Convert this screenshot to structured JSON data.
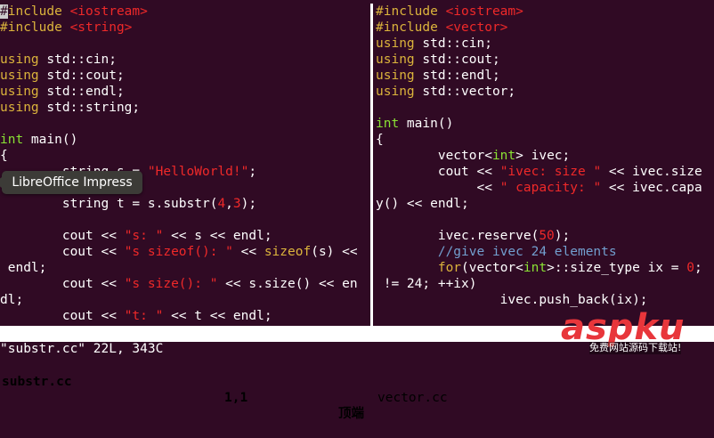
{
  "left_pane": {
    "lines": [
      [
        [
          "#",
          "cursor"
        ],
        [
          "include ",
          "keyword"
        ],
        [
          "<iostream>",
          "string"
        ]
      ],
      [
        [
          "#include ",
          "keyword"
        ],
        [
          "<string>",
          "string"
        ]
      ],
      [],
      [
        [
          "using",
          "keyword"
        ],
        [
          " std::cin;",
          ""
        ]
      ],
      [
        [
          "using",
          "keyword"
        ],
        [
          " std::cout;",
          ""
        ]
      ],
      [
        [
          "using",
          "keyword"
        ],
        [
          " std::endl;",
          ""
        ]
      ],
      [
        [
          "using",
          "keyword"
        ],
        [
          " std::string;",
          ""
        ]
      ],
      [],
      [
        [
          "int",
          "type"
        ],
        [
          " main()",
          ""
        ]
      ],
      [
        [
          "{",
          ""
        ]
      ],
      [
        [
          "        string s = ",
          ""
        ],
        [
          "\"HelloWorld!\"",
          "string"
        ],
        [
          ";",
          ""
        ]
      ],
      [],
      [
        [
          "        string t = s.substr(",
          ""
        ],
        [
          "4",
          "number"
        ],
        [
          ",",
          ""
        ],
        [
          "3",
          "number"
        ],
        [
          ");",
          ""
        ]
      ],
      [],
      [
        [
          "        cout << ",
          ""
        ],
        [
          "\"s: \"",
          "string"
        ],
        [
          " << s << endl;",
          ""
        ]
      ],
      [
        [
          "        cout << ",
          ""
        ],
        [
          "\"s sizeof(): \"",
          "string"
        ],
        [
          " << ",
          ""
        ],
        [
          "sizeof",
          "func"
        ],
        [
          "(s) <<",
          ""
        ]
      ],
      [
        [
          " endl;",
          ""
        ]
      ],
      [
        [
          "        cout << ",
          ""
        ],
        [
          "\"s size(): \"",
          "string"
        ],
        [
          " << s.size() << en",
          ""
        ]
      ],
      [
        [
          "dl;",
          ""
        ]
      ],
      [
        [
          "        cout << ",
          ""
        ],
        [
          "\"t: \"",
          "string"
        ],
        [
          " << t << endl;",
          ""
        ]
      ]
    ]
  },
  "right_pane": {
    "lines": [
      [
        [
          "#include ",
          "keyword"
        ],
        [
          "<iostream>",
          "string"
        ]
      ],
      [
        [
          "#include ",
          "keyword"
        ],
        [
          "<vector>",
          "string"
        ]
      ],
      [
        [
          "using",
          "keyword"
        ],
        [
          " std::cin;",
          ""
        ]
      ],
      [
        [
          "using",
          "keyword"
        ],
        [
          " std::cout;",
          ""
        ]
      ],
      [
        [
          "using",
          "keyword"
        ],
        [
          " std::endl;",
          ""
        ]
      ],
      [
        [
          "using",
          "keyword"
        ],
        [
          " std::vector;",
          ""
        ]
      ],
      [],
      [
        [
          "int",
          "type"
        ],
        [
          " main()",
          ""
        ]
      ],
      [
        [
          "{",
          ""
        ]
      ],
      [
        [
          "        vector<",
          ""
        ],
        [
          "int",
          "type"
        ],
        [
          "> ivec;",
          ""
        ]
      ],
      [
        [
          "        cout << ",
          ""
        ],
        [
          "\"ivec: size \"",
          "string"
        ],
        [
          " << ivec.size",
          ""
        ]
      ],
      [
        [
          "             << ",
          ""
        ],
        [
          "\" capacity: \"",
          "string"
        ],
        [
          " << ivec.capa",
          ""
        ]
      ],
      [
        [
          "y() << endl;",
          ""
        ]
      ],
      [],
      [
        [
          "        ivec.reserve(",
          ""
        ],
        [
          "50",
          "number"
        ],
        [
          ");",
          ""
        ]
      ],
      [
        [
          "        //give ivec 24 elements",
          "comment"
        ]
      ],
      [
        [
          "        ",
          ""
        ],
        [
          "for",
          "keyword"
        ],
        [
          "(vector<",
          ""
        ],
        [
          "int",
          "type"
        ],
        [
          ">::size_type ix = ",
          ""
        ],
        [
          "0",
          "number"
        ],
        [
          ";",
          ""
        ]
      ],
      [
        [
          " != 24; ++ix)",
          ""
        ]
      ],
      [
        [
          "                ivec.push_back(ix);",
          ""
        ]
      ]
    ]
  },
  "status": {
    "left_file": "substr.cc",
    "left_position": "1,1",
    "left_scroll": "顶端",
    "right_file": "vector.cc"
  },
  "message_line": "\"substr.cc\" 22L, 343C",
  "tooltip": {
    "label": "LibreOffice Impress"
  },
  "watermark": {
    "logo": "aspku",
    "subtitle": "免费网站源码下载站!"
  },
  "colors": {
    "background": "#300a24",
    "keyword": "#dcb43c",
    "type": "#8ae234",
    "string": "#ef2929",
    "comment": "#729fcf"
  }
}
